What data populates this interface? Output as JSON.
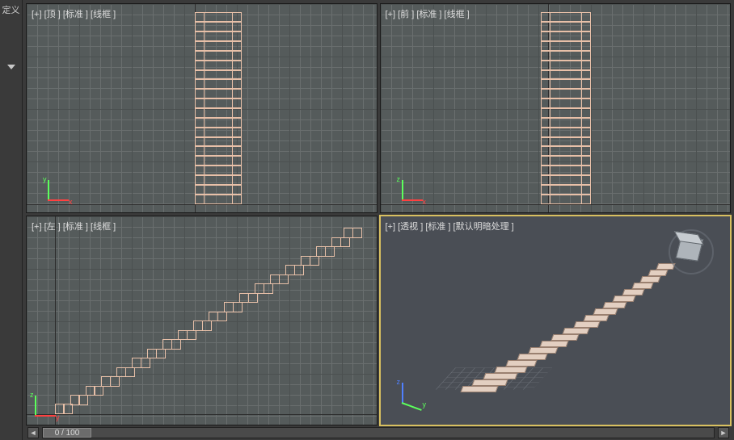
{
  "sidebar": {
    "label": "定义"
  },
  "viewports": {
    "top": {
      "label": "[+] [顶 ] [标准 ] [线框 ]"
    },
    "front": {
      "label": "[+] [前 ] [标准 ] [线框 ]"
    },
    "left": {
      "label": "[+] [左 ] [标准 ] [线框 ]"
    },
    "persp": {
      "label": "[+] [透视 ] [标准 ] [默认明暗处理 ]"
    }
  },
  "gizmo": {
    "x": "x",
    "y": "y",
    "z": "z"
  },
  "timeline": {
    "prev": "◄",
    "next": "►",
    "position": "0 / 100"
  },
  "colors": {
    "wire": "#e8c0a8",
    "active_outline": "#d8c060"
  }
}
